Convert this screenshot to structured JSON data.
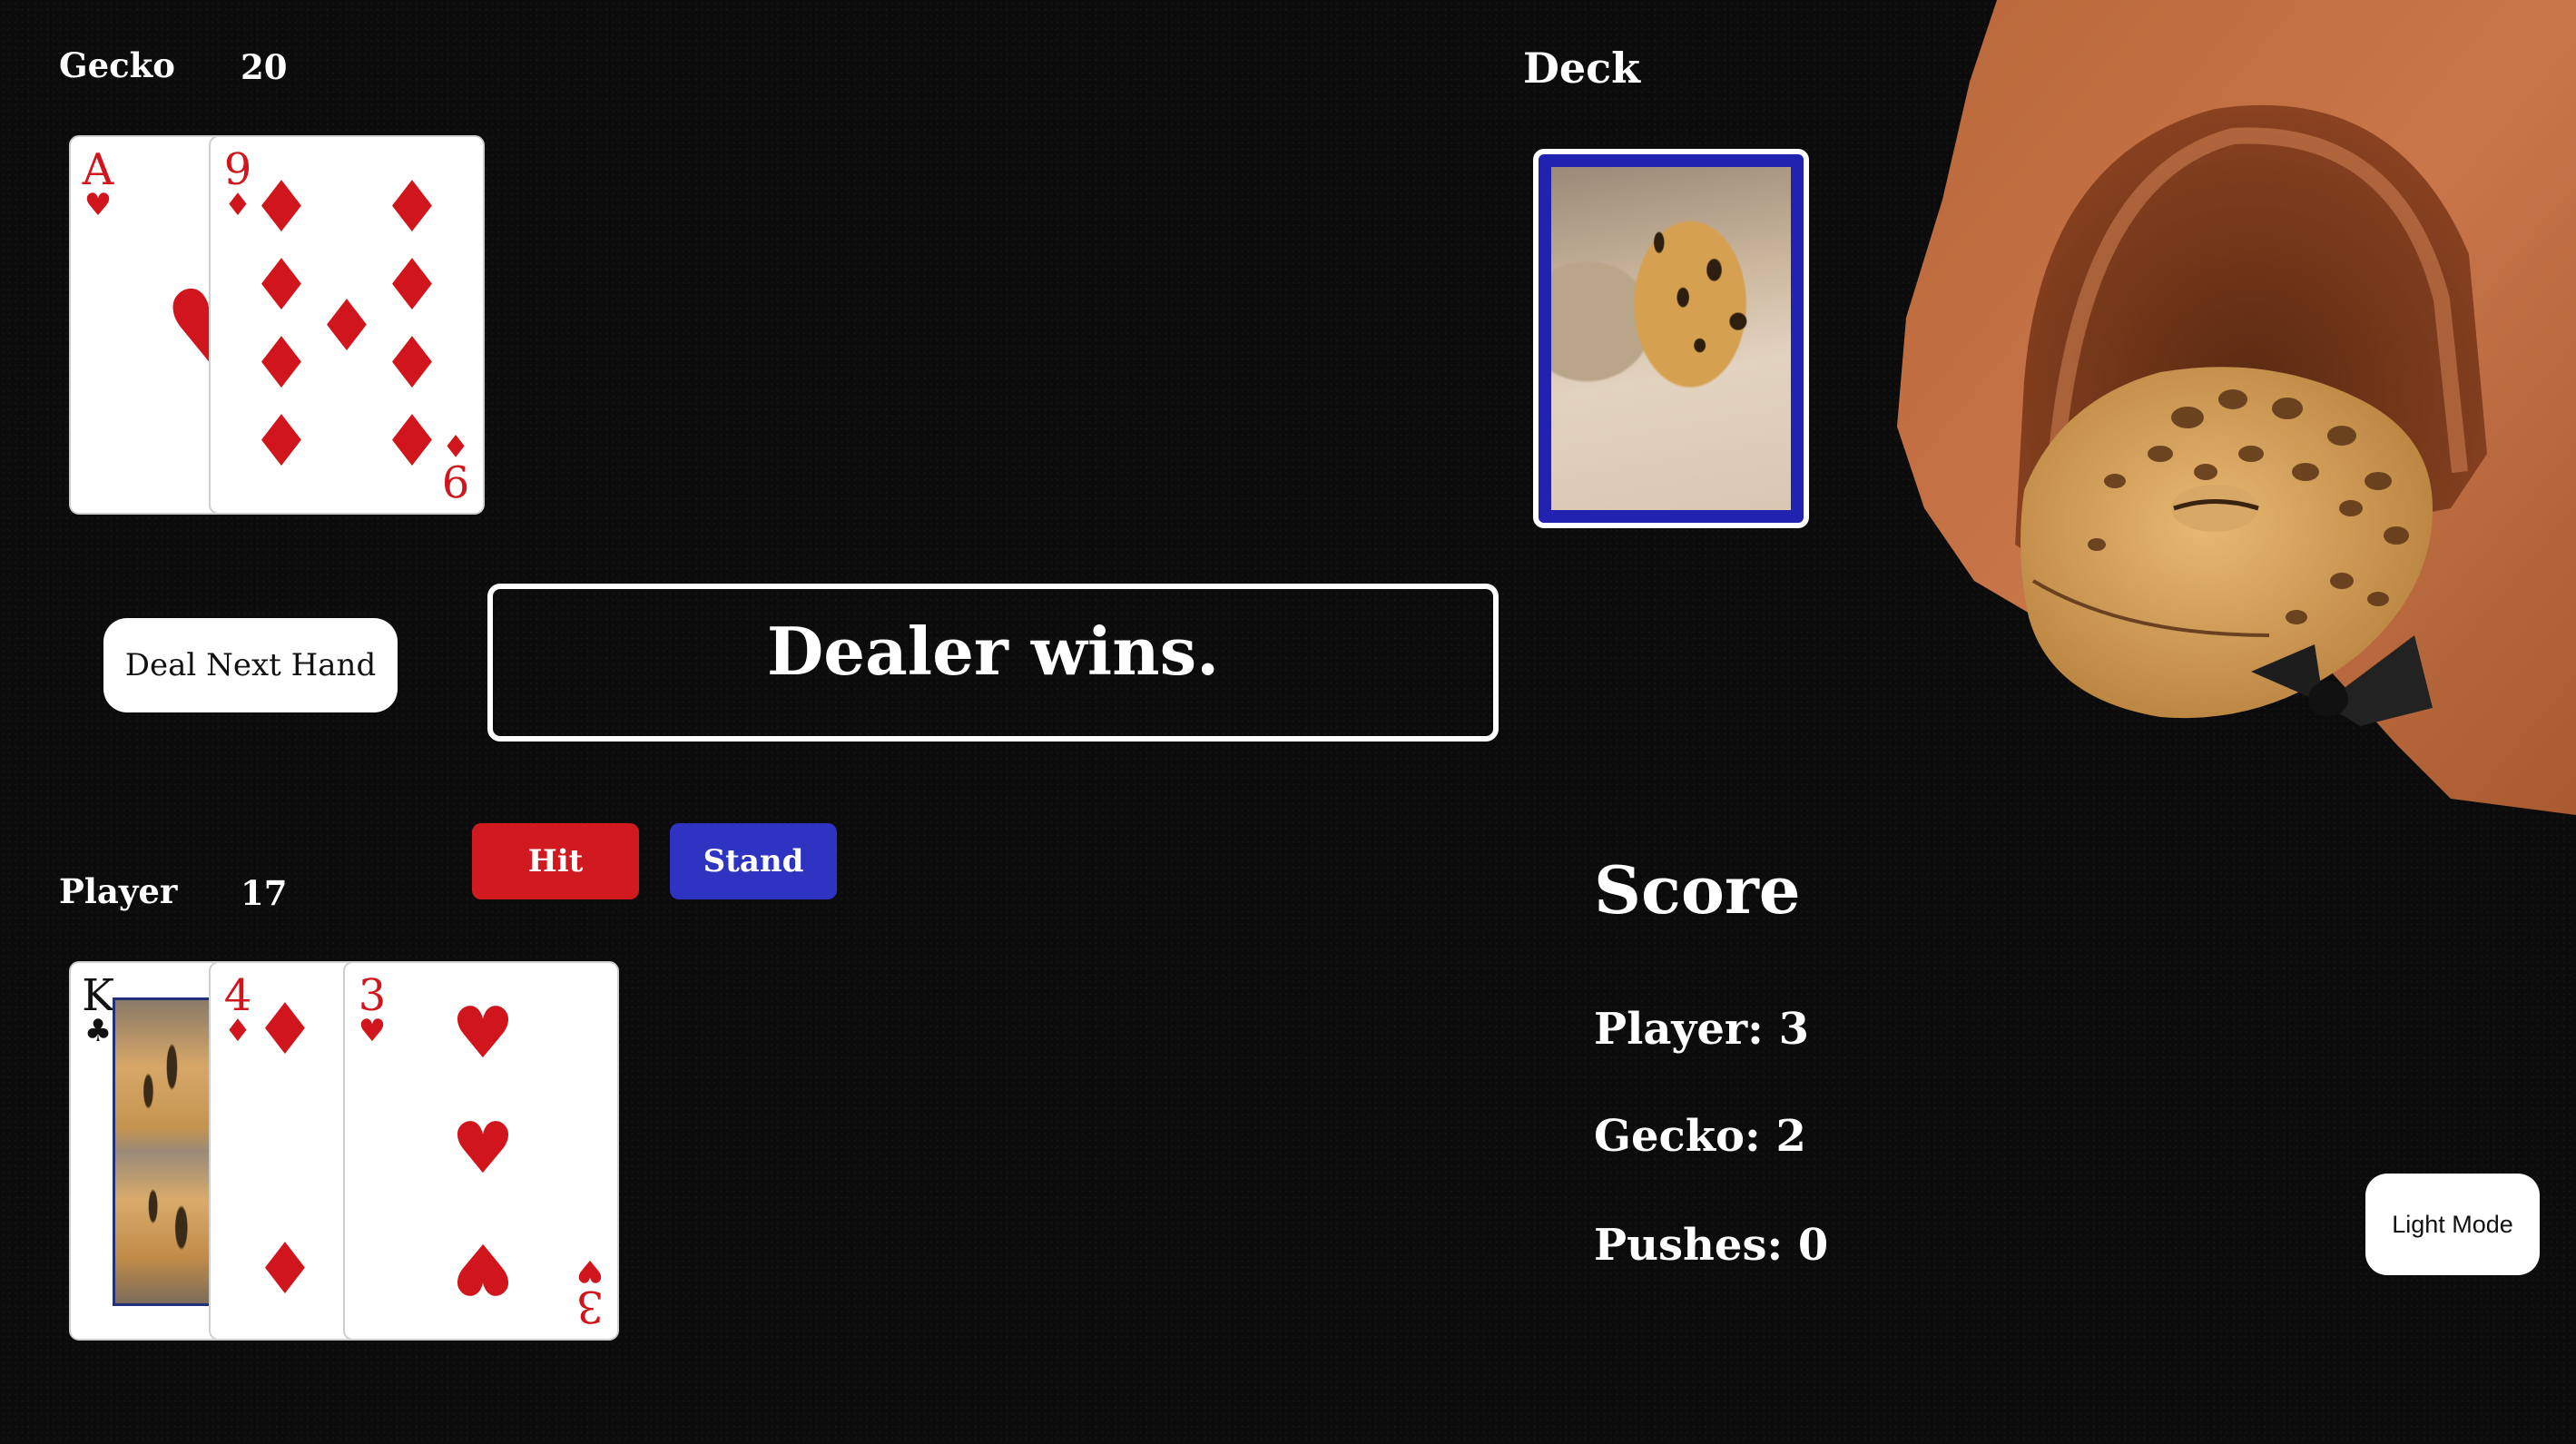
{
  "dealer": {
    "label": "Gecko",
    "total": "20",
    "cards": [
      {
        "rank": "A",
        "suit": "♥",
        "color": "red"
      },
      {
        "rank": "9",
        "suit": "♦",
        "color": "red"
      }
    ]
  },
  "player": {
    "label": "Player",
    "total": "17",
    "cards": [
      {
        "rank": "K",
        "suit": "♣",
        "color": "black"
      },
      {
        "rank": "4",
        "suit": "♦",
        "color": "red"
      },
      {
        "rank": "3",
        "suit": "♥",
        "color": "red"
      }
    ]
  },
  "deck": {
    "label": "Deck"
  },
  "controls": {
    "deal_label": "Deal Next Hand",
    "hit_label": "Hit",
    "stand_label": "Stand",
    "light_mode_label": "Light Mode"
  },
  "message": "Dealer wins.",
  "score": {
    "title": "Score",
    "player": "Player: 3",
    "gecko": "Gecko: 2",
    "pushes": "Pushes: 0"
  },
  "colors": {
    "background": "#0b0b0b",
    "hit": "#d11a1f",
    "stand": "#2f33c1",
    "card_red": "#d0161c",
    "deck_border": "#2222b0"
  }
}
